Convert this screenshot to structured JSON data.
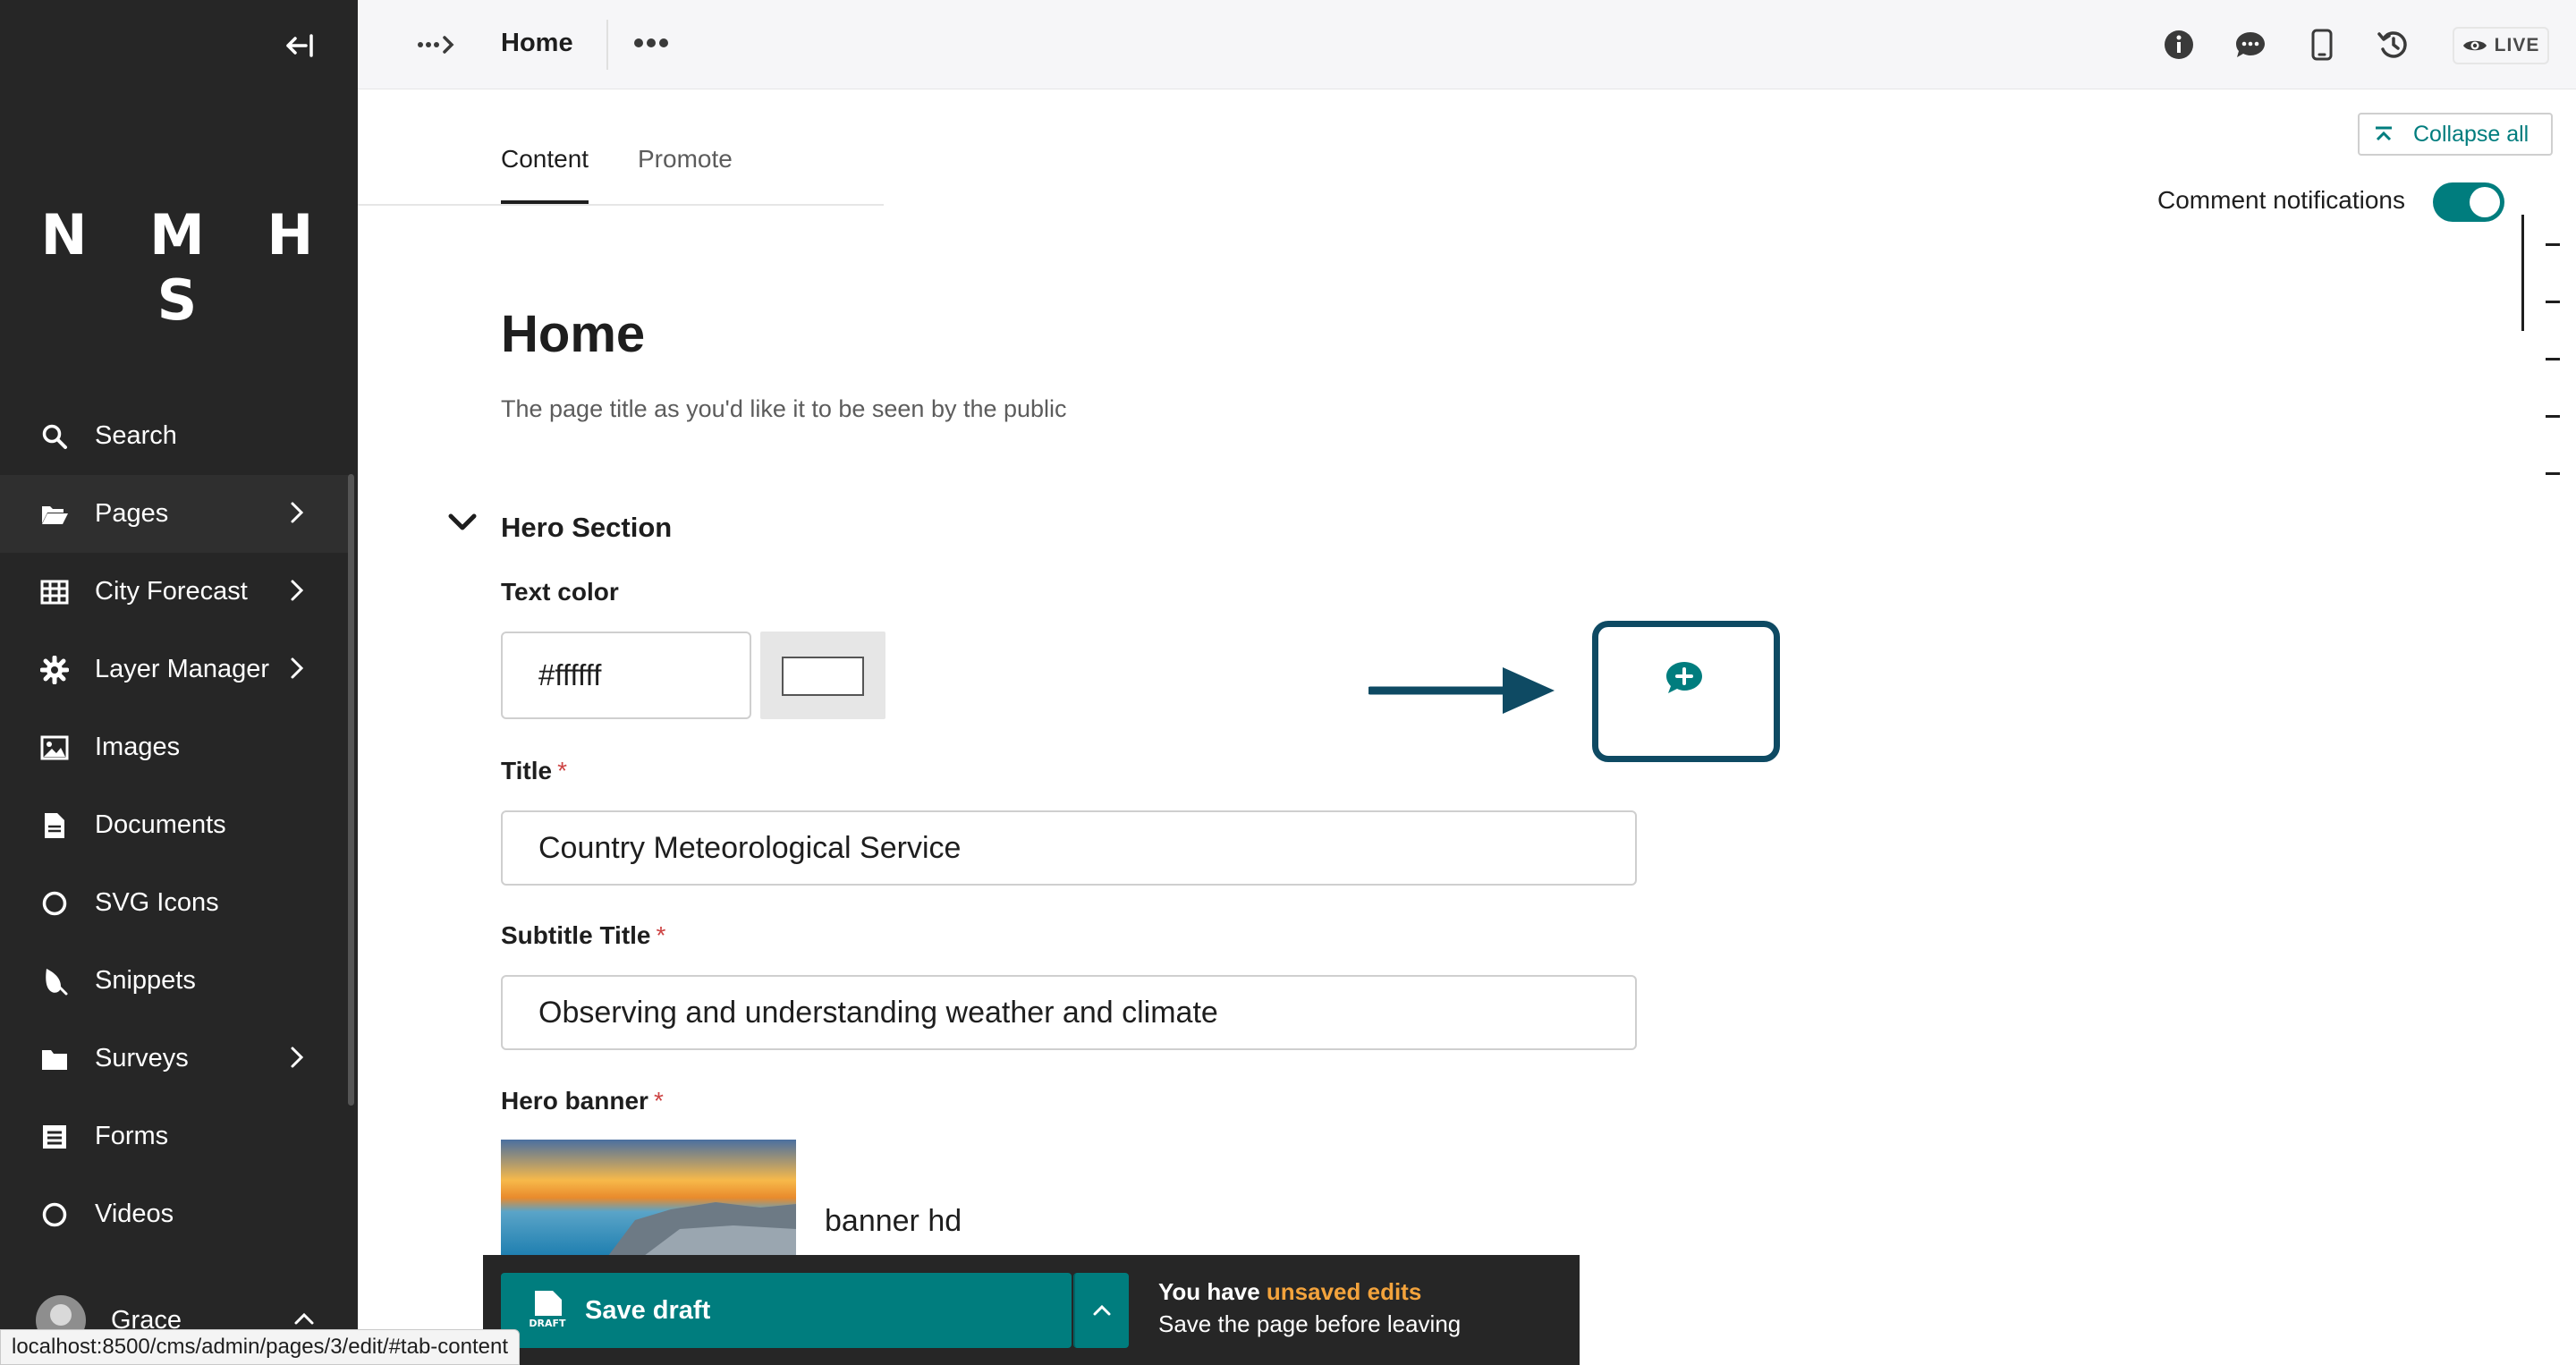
{
  "sidebar": {
    "logo": "N M H S",
    "items": [
      {
        "label": "Search",
        "icon": "search-icon"
      },
      {
        "label": "Pages",
        "icon": "folder-open-icon",
        "has_submenu": true
      },
      {
        "label": "City Forecast",
        "icon": "table-icon",
        "has_submenu": true
      },
      {
        "label": "Layer Manager",
        "icon": "cog-icon",
        "has_submenu": true
      },
      {
        "label": "Images",
        "icon": "image-icon"
      },
      {
        "label": "Documents",
        "icon": "document-icon"
      },
      {
        "label": "SVG Icons",
        "icon": "circle-icon"
      },
      {
        "label": "Snippets",
        "icon": "snippet-icon"
      },
      {
        "label": "Surveys",
        "icon": "folder-icon",
        "has_submenu": true
      },
      {
        "label": "Forms",
        "icon": "form-icon"
      },
      {
        "label": "Videos",
        "icon": "circle-icon"
      }
    ],
    "user_name": "Grace"
  },
  "header": {
    "page_name": "Home",
    "live_label": "LIVE"
  },
  "tabs": [
    {
      "label": "Content",
      "active": true
    },
    {
      "label": "Promote",
      "active": false
    }
  ],
  "controls": {
    "collapse_all": "Collapse all",
    "comment_notifications": "Comment notifications",
    "comment_notifications_on": true
  },
  "page": {
    "title": "Home",
    "title_help": "The page title as you'd like it to be seen by the public"
  },
  "hero": {
    "section_title": "Hero Section",
    "text_color_label": "Text color",
    "text_color_value": "#ffffff",
    "title_label": "Title",
    "title_value": "Country Meteorological Service",
    "subtitle_label": "Subtitle Title",
    "subtitle_value": "Observing and understanding weather and climate",
    "banner_label": "Hero banner",
    "banner_name": "banner hd",
    "required_mark": "*"
  },
  "footer": {
    "save_label": "Save draft",
    "draft_badge": "DRAFT",
    "unsaved_prefix": "You have",
    "unsaved_highlight": "unsaved edits",
    "unsaved_hint": "Save the page before leaving"
  },
  "status_url": "localhost:8500/cms/admin/pages/3/edit/#tab-content",
  "colors": {
    "sidebar_bg": "#262626",
    "primary": "#007d7e",
    "annotation": "#0e4a63",
    "warning": "#f3a33c",
    "required": "#cd4444"
  }
}
